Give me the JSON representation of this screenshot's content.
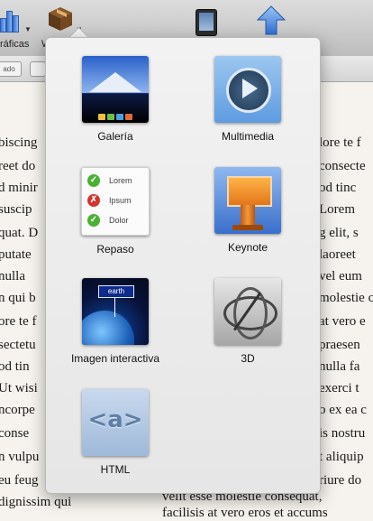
{
  "toolbar": {
    "items": [
      {
        "icon": "charts-icon",
        "label": "ráficas"
      },
      {
        "icon": "widgets-icon",
        "label": "W"
      },
      {
        "icon": "ipad-preview-icon"
      },
      {
        "icon": "publish-arrow-icon"
      }
    ]
  },
  "formatbar": {
    "btn1": "ado",
    "btn2": ""
  },
  "document": {
    "left_lines": [
      "biscing",
      "reet do",
      "d minir",
      "suscip",
      "quat. D",
      "putate",
      "nulla",
      "n qui b",
      "ore te f",
      "sectetu",
      "od tin",
      "Ut wisi",
      "ncorpe",
      "conse",
      "n vulpu",
      "eu feug",
      "dignissim qui"
    ],
    "right_lines": [
      "lore te f",
      "consecte",
      "od tinc",
      "Lorem",
      "g elit, s",
      "laoreet",
      "vel eum",
      "molestie c",
      "at vero e",
      "praesen",
      "nulla fa",
      "exerci t",
      "o ex ea c",
      "is nostru",
      "t aliquip",
      "riure do",
      "velit esse molestie consequat,",
      "facilisis at vero eros et accums"
    ]
  },
  "widgets": [
    {
      "label": "Galería",
      "icon": "gallery-icon"
    },
    {
      "label": "Multimedia",
      "icon": "multimedia-icon"
    },
    {
      "label": "Repaso",
      "icon": "review-icon",
      "rows": [
        "Lorem",
        "Ipsum",
        "Dolor"
      ]
    },
    {
      "label": "Keynote",
      "icon": "keynote-icon"
    },
    {
      "label": "Imagen interactiva",
      "icon": "interactive-image-icon",
      "tag": "earth"
    },
    {
      "label": "3D",
      "icon": "3d-icon"
    },
    {
      "label": "HTML",
      "icon": "html-icon",
      "code": "<a>"
    }
  ],
  "colors": {
    "accent": "#3b78d8",
    "popover_bg": "#ededed"
  }
}
